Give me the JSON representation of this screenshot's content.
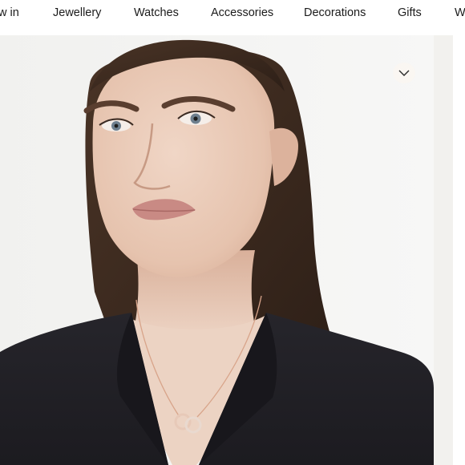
{
  "nav": {
    "items": [
      {
        "label": "w in"
      },
      {
        "label": "Jewellery"
      },
      {
        "label": "Watches"
      },
      {
        "label": "Accessories"
      },
      {
        "label": "Decorations"
      },
      {
        "label": "Gifts"
      },
      {
        "label": "W"
      }
    ]
  },
  "icons": {
    "scroll_chevron": "chevron-down-icon"
  }
}
